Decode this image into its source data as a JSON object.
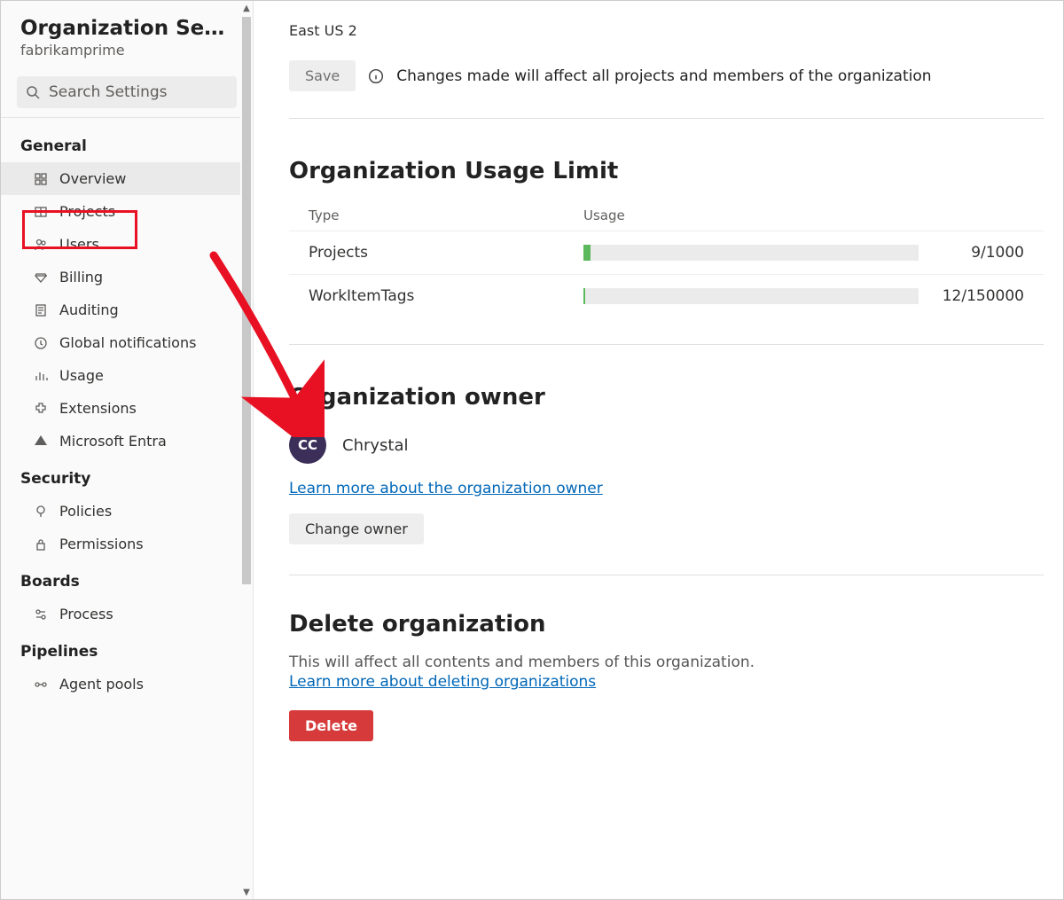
{
  "sidebar": {
    "title": "Organization Settin...",
    "subtitle": "fabrikamprime",
    "search_placeholder": "Search Settings",
    "sections": {
      "general": "General",
      "security": "Security",
      "boards": "Boards",
      "pipelines": "Pipelines"
    },
    "items": {
      "overview": "Overview",
      "projects": "Projects",
      "users": "Users",
      "billing": "Billing",
      "auditing": "Auditing",
      "global_notifications": "Global notifications",
      "usage": "Usage",
      "extensions": "Extensions",
      "entra": "Microsoft Entra",
      "policies": "Policies",
      "permissions": "Permissions",
      "process": "Process",
      "agent_pools": "Agent pools"
    }
  },
  "main": {
    "region": "East US 2",
    "save_label": "Save",
    "save_info": "Changes made will affect all projects and members of the organization",
    "usage_limit": {
      "title": "Organization Usage Limit",
      "col_type": "Type",
      "col_usage": "Usage",
      "rows": [
        {
          "type": "Projects",
          "used": 9,
          "limit": 1000,
          "display": "9/1000"
        },
        {
          "type": "WorkItemTags",
          "used": 12,
          "limit": 150000,
          "display": "12/150000"
        }
      ]
    },
    "owner": {
      "title": "Organization owner",
      "initials": "CC",
      "name": "Chrystal",
      "learn_more": "Learn more about the organization owner",
      "change_label": "Change owner"
    },
    "delete": {
      "title": "Delete organization",
      "desc": "This will affect all contents and members of this organization.",
      "learn_more": "Learn more about deleting organizations",
      "button": "Delete"
    }
  }
}
